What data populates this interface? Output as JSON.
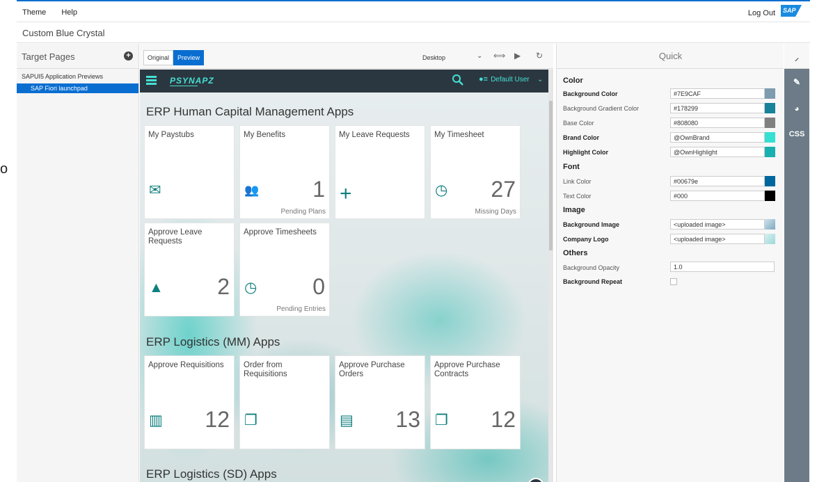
{
  "topbar": {
    "menu": [
      "Theme",
      "Help"
    ],
    "logout": "Log Out",
    "logo": "SAP"
  },
  "theme_title": "Custom Blue Crystal",
  "stray_char": "o",
  "left_pane": {
    "title": "Target Pages",
    "group": "SAPUI5 Application Previews",
    "selected_item": "SAP Fiori launchpad"
  },
  "middle": {
    "tabs": [
      "Original",
      "Preview"
    ],
    "active_tab": "Preview",
    "device": "Desktop",
    "shell": {
      "brand": "PSYNAPZ",
      "user": "Default User"
    },
    "groups": [
      {
        "title": "ERP Human Capital Management Apps",
        "tiles": [
          {
            "title": "My Paystubs",
            "icon": "paystub-icon",
            "number": "",
            "footer": ""
          },
          {
            "title": "My Benefits",
            "icon": "people-icon",
            "number": "1",
            "footer": "Pending Plans"
          },
          {
            "title": "My Leave Requests",
            "icon": "add-icon",
            "number": "",
            "footer": ""
          },
          {
            "title": "My Timesheet",
            "icon": "timesheet-icon",
            "number": "27",
            "footer": "Missing Days"
          },
          {
            "title": "Approve Leave Requests",
            "icon": "leave-icon",
            "number": "2",
            "footer": ""
          },
          {
            "title": "Approve Timesheets",
            "icon": "timesheet-icon",
            "number": "0",
            "footer": "Pending Entries"
          }
        ]
      },
      {
        "title": "ERP Logistics (MM) Apps",
        "tiles": [
          {
            "title": "Approve Requisitions",
            "icon": "barcode-icon",
            "number": "12",
            "footer": ""
          },
          {
            "title": "Order from Requisitions",
            "icon": "documents-icon",
            "number": "",
            "footer": ""
          },
          {
            "title": "Approve Purchase Orders",
            "icon": "purchase-order-icon",
            "number": "13",
            "footer": ""
          },
          {
            "title": "Approve Purchase Contracts",
            "icon": "documents-icon",
            "number": "12",
            "footer": ""
          }
        ]
      },
      {
        "title": "ERP Logistics (SD) Apps",
        "tiles": []
      }
    ]
  },
  "right_pane": {
    "title": "Quick",
    "sections": [
      {
        "title": "Color",
        "props": [
          {
            "label": "Background Color",
            "bold": true,
            "value": "#7E9CAF",
            "swatch": "#7E9CAF"
          },
          {
            "label": "Background Gradient Color",
            "bold": false,
            "value": "#178299",
            "swatch": "#178299"
          },
          {
            "label": "Base Color",
            "bold": false,
            "value": "#808080",
            "swatch": "#808080"
          },
          {
            "label": "Brand Color",
            "bold": true,
            "value": "@OwnBrand",
            "swatch": "#36e0d3"
          },
          {
            "label": "Highlight Color",
            "bold": true,
            "value": "@OwnHighlight",
            "swatch": "#1ab0b0"
          }
        ]
      },
      {
        "title": "Font",
        "props": [
          {
            "label": "Link Color",
            "bold": false,
            "value": "#00679e",
            "swatch": "#00679e"
          },
          {
            "label": "Text Color",
            "bold": false,
            "value": "#000",
            "swatch": "#000000"
          }
        ]
      },
      {
        "title": "Image",
        "props": [
          {
            "label": "Background Image",
            "bold": true,
            "value": "<uploaded image>",
            "swatch": "image"
          },
          {
            "label": "Company Logo",
            "bold": true,
            "value": "<uploaded image>",
            "swatch": "image"
          }
        ]
      },
      {
        "title": "Others",
        "props": [
          {
            "label": "Background Opacity",
            "bold": false,
            "value": "1.0",
            "swatch": ""
          },
          {
            "label": "Background Repeat",
            "bold": true,
            "value": "",
            "swatch": "checkbox"
          }
        ]
      }
    ]
  },
  "right_sidebar": {
    "css_label": "CSS"
  }
}
